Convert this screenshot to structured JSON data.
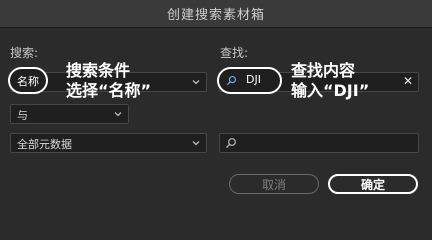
{
  "window": {
    "title": "创建搜索素材箱"
  },
  "search": {
    "label": "搜索:",
    "condition_value": "名称",
    "connector_value": "与",
    "scope_value": "全部元数据"
  },
  "find": {
    "label": "查找:",
    "query_value": "DJI",
    "clear_glyph": "✕",
    "second_query_value": ""
  },
  "annotations": {
    "left_line1": "搜索条件",
    "left_line2": "选择“名称”",
    "right_line1": "查找内容",
    "right_line2": "输入“DJI”"
  },
  "buttons": {
    "cancel": "取消",
    "ok": "确定"
  },
  "colors": {
    "background": "#2b2b2b",
    "field": "#1f1f1f",
    "annotation": "#ffffff"
  }
}
